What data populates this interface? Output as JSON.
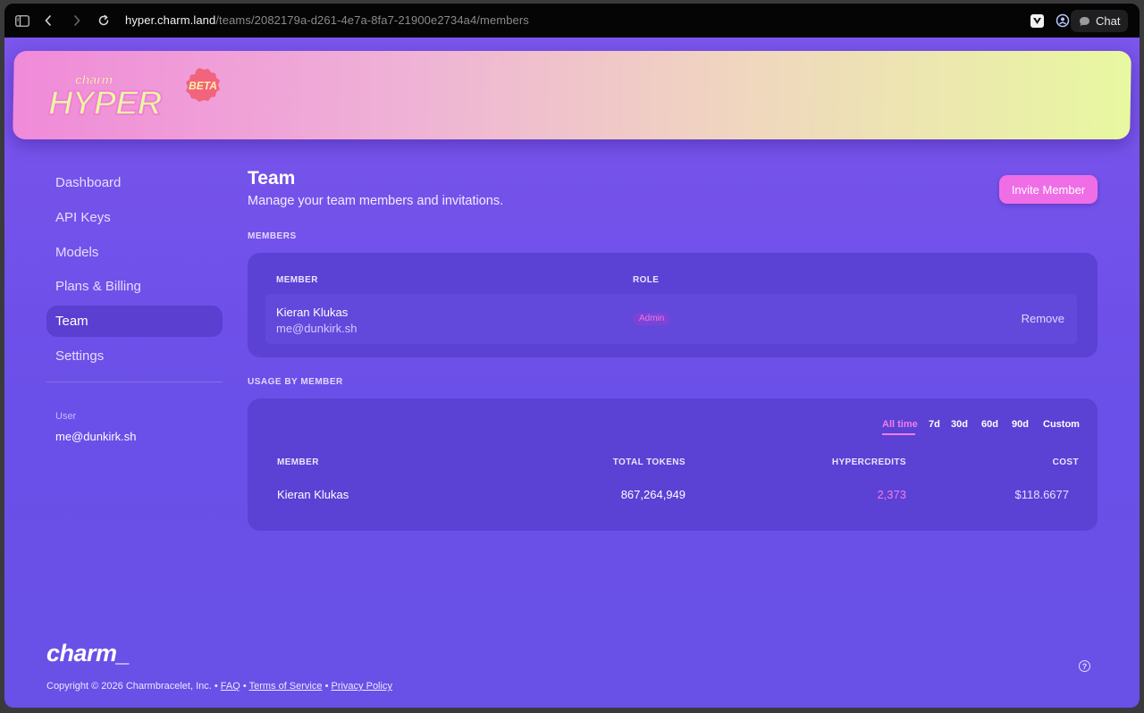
{
  "browser": {
    "url_host": "hyper.charm.land",
    "url_path": "/teams/2082179a-d261-4e7a-8fa7-21900e2734a4/members",
    "chat_label": "Chat"
  },
  "brand": {
    "logo_small": "charm",
    "logo_big": "HYPER",
    "beta_badge": "BETA",
    "footer_logo": "charm_"
  },
  "sidebar": {
    "items": [
      {
        "label": "Dashboard",
        "active": false
      },
      {
        "label": "API Keys",
        "active": false
      },
      {
        "label": "Models",
        "active": false
      },
      {
        "label": "Plans & Billing",
        "active": false
      },
      {
        "label": "Team",
        "active": true
      },
      {
        "label": "Settings",
        "active": false
      }
    ],
    "user_label": "User",
    "user_email": "me@dunkirk.sh"
  },
  "main": {
    "title": "Team",
    "subtitle": "Manage your team members and invitations.",
    "invite_button": "Invite Member",
    "members_section": "MEMBERS",
    "members_table": {
      "headers": {
        "member": "MEMBER",
        "role": "ROLE"
      },
      "rows": [
        {
          "name": "Kieran Klukas",
          "email": "me@dunkirk.sh",
          "role": "Admin",
          "action": "Remove"
        }
      ]
    },
    "usage_section": "USAGE BY MEMBER",
    "usage_ranges": [
      "All time",
      "7d",
      "30d",
      "60d",
      "90d",
      "Custom"
    ],
    "usage_active_range": "All time",
    "usage_table": {
      "headers": {
        "member": "MEMBER",
        "tokens": "TOTAL TOKENS",
        "credits": "HYPERCREDITS",
        "cost": "COST"
      },
      "rows": [
        {
          "member": "Kieran Klukas",
          "tokens": "867,264,949",
          "credits": "2,373",
          "cost": "$118.6677"
        }
      ]
    }
  },
  "footer": {
    "copyright": "Copyright © 2026 Charmbracelet, Inc. •",
    "links": [
      "FAQ",
      "Terms of Service",
      "Privacy Policy"
    ],
    "sep": "•"
  },
  "colors": {
    "accent_pink": "#ef6ee6",
    "page_purple": "#7b55ec",
    "card_purple": "#5b41d4",
    "hero_start": "#f08ad9",
    "hero_end": "#e8f8a0"
  }
}
